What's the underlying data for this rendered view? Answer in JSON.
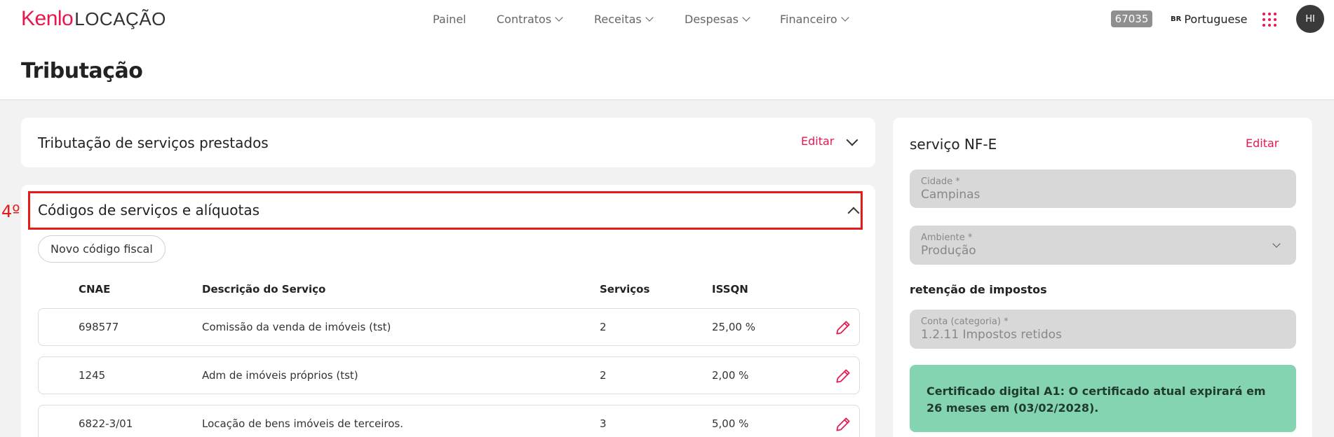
{
  "header": {
    "logo_brand": "Kenlo",
    "logo_product": "LOCAÇÃO",
    "nav": [
      {
        "label": "Painel",
        "has_dropdown": false
      },
      {
        "label": "Contratos",
        "has_dropdown": true
      },
      {
        "label": "Receitas",
        "has_dropdown": true
      },
      {
        "label": "Despesas",
        "has_dropdown": true
      },
      {
        "label": "Financeiro",
        "has_dropdown": true
      }
    ],
    "account_id": "67035",
    "language_flag": "BR",
    "language": "Portuguese",
    "avatar_initials": "HI"
  },
  "page": {
    "title": "Tributação"
  },
  "services_tax_card": {
    "title": "Tributação de serviços prestados",
    "edit_label": "Editar"
  },
  "codes_card": {
    "title": "Códigos de serviços e alíquotas",
    "step_label": "4º",
    "new_button": "Novo código fiscal",
    "columns": [
      "CNAE",
      "Descrição do Serviço",
      "Serviços",
      "ISSQN"
    ],
    "rows": [
      {
        "cnae": "698577",
        "description": "Comissão da venda de imóveis (tst)",
        "services": "2",
        "issqn": "25,00 %"
      },
      {
        "cnae": "1245",
        "description": "Adm de imóveis próprios (tst)",
        "services": "2",
        "issqn": "2,00 %"
      },
      {
        "cnae": "6822-3/01",
        "description": "Locação de bens imóveis de terceiros.",
        "services": "3",
        "issqn": "5,00 %"
      }
    ]
  },
  "nfe_card": {
    "title": "serviço NF-E",
    "edit_label": "Editar",
    "city": {
      "label": "Cidade *",
      "value": "Campinas"
    },
    "environment": {
      "label": "Ambiente *",
      "value": "Produção"
    },
    "retention_title": "retenção de impostos",
    "account": {
      "label": "Conta (categoria) *",
      "value": "1.2.11 Impostos retidos"
    },
    "certificate_message": "Certificado digital A1: O certificado atual expirará em 26 meses em (03/02/2028)."
  },
  "colors": {
    "accent": "#e8174d",
    "highlight_border": "#e51b1b",
    "certificate_bg": "#85d4b1"
  }
}
